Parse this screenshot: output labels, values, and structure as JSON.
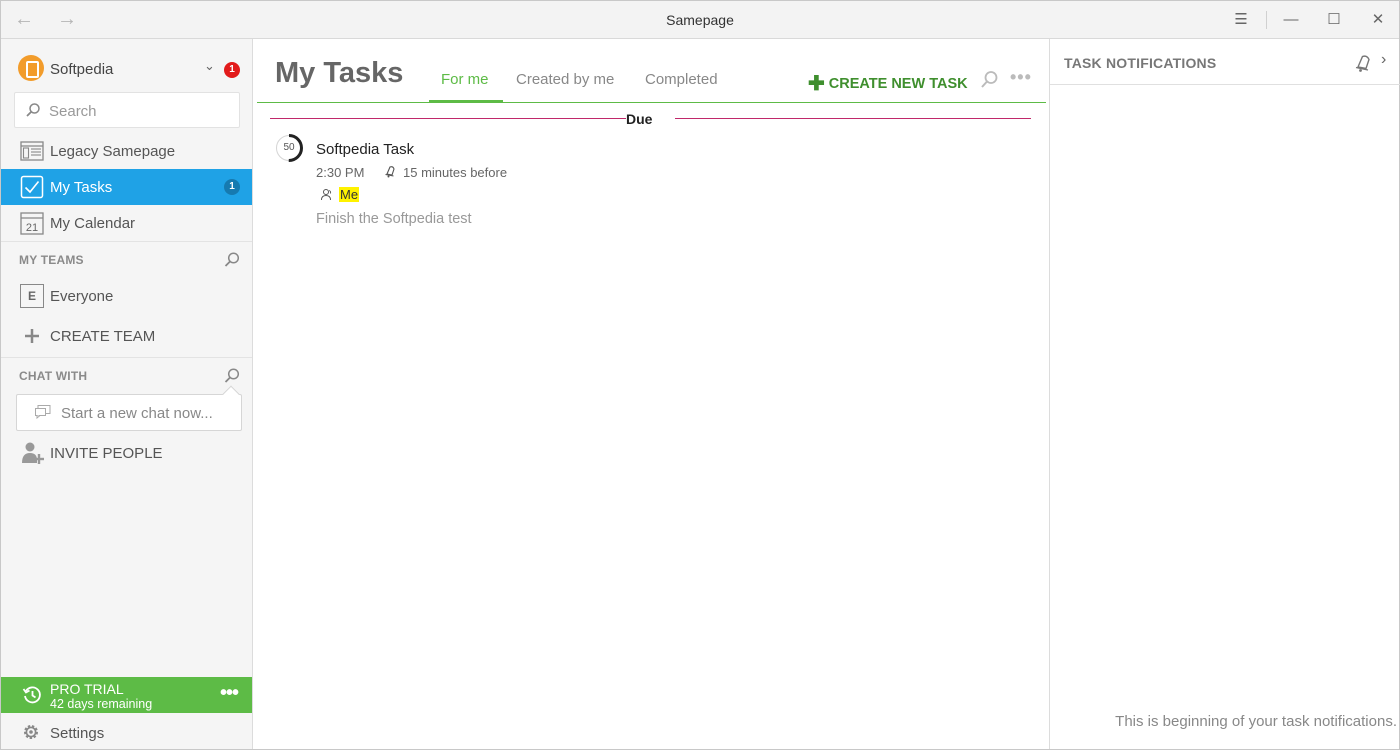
{
  "window": {
    "title": "Samepage"
  },
  "sidebar": {
    "org_name": "Softpedia",
    "org_notifications": "1",
    "search_placeholder": "Search",
    "items": [
      {
        "label": "Legacy Samepage"
      },
      {
        "label": "My Tasks",
        "count": "1"
      },
      {
        "label": "My Calendar",
        "icon_text": "21"
      }
    ],
    "teams_heading": "MY TEAMS",
    "teams": [
      {
        "label": "Everyone",
        "initial": "E"
      }
    ],
    "create_team": "CREATE TEAM",
    "chat_heading": "CHAT WITH",
    "chat_placeholder": "Start a new chat now...",
    "invite_people": "INVITE PEOPLE",
    "pro_trial": {
      "title": "PRO TRIAL",
      "remaining": "42 days remaining"
    },
    "settings": "Settings"
  },
  "main": {
    "title": "My Tasks",
    "tabs": [
      {
        "label": "For me",
        "active": true
      },
      {
        "label": "Created by me",
        "active": false
      },
      {
        "label": "Completed",
        "active": false
      }
    ],
    "create_task": "CREATE NEW TASK",
    "group_label": "Due",
    "tasks": [
      {
        "progress": "50",
        "progress_fraction": 0.5,
        "title": "Softpedia Task",
        "time": "2:30 PM",
        "reminder": "15 minutes before",
        "assignee": "Me",
        "description": "Finish the Softpedia test"
      }
    ]
  },
  "notifications": {
    "heading": "TASK NOTIFICATIONS",
    "empty_text": "This is beginning of your task notifications."
  },
  "colors": {
    "accent_blue": "#1fa2e6",
    "accent_green": "#5dbb46",
    "create_green": "#3f8f2e",
    "badge_red": "#e21b1b",
    "due_line": "#c0286a",
    "highlight": "#fff200"
  }
}
